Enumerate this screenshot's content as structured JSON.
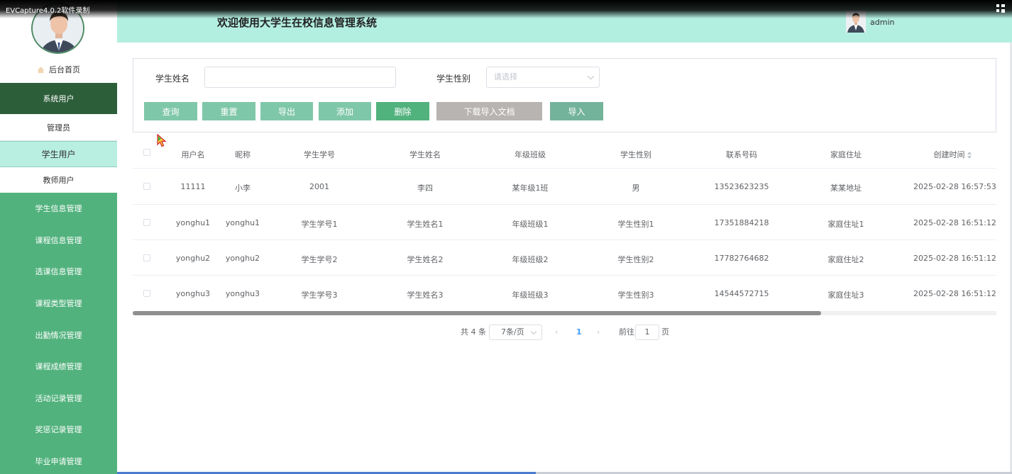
{
  "recorder": {
    "title": "EVCapture4.0.2软件录制"
  },
  "sidebar": {
    "home_label": "后台首页",
    "categories": [
      {
        "label": "系统用户",
        "items": [
          "管理员",
          "学生用户",
          "教师用户"
        ]
      }
    ],
    "menu": [
      "学生信息管理",
      "课程信息管理",
      "选课信息管理",
      "课程类型管理",
      "出勤情况管理",
      "课程成绩管理",
      "活动记录管理",
      "奖惩记录管理",
      "毕业申请管理"
    ]
  },
  "header": {
    "title": "欢迎使用大学生在校信息管理系统",
    "username": "admin"
  },
  "search": {
    "name_label": "学生姓名",
    "name_value": "",
    "gender_label": "学生性别",
    "gender_placeholder": "请选择"
  },
  "buttons": {
    "query": "查询",
    "reset": "重置",
    "export": "导出",
    "add": "添加",
    "delete": "删除",
    "download_template": "下载导入文档",
    "import": "导入"
  },
  "colors": {
    "sidebar_dark": "#2d5e3a",
    "sidebar_green": "#52b27d",
    "header_bg": "#b3efe1",
    "active_item": "#b8efe0",
    "btn_light": "#7fc7a9",
    "btn_delete": "#52b27d",
    "btn_gray": "#b7b4b1",
    "btn_import": "#74b39b"
  },
  "table": {
    "columns": [
      "用户名",
      "昵称",
      "学生学号",
      "学生姓名",
      "年级班级",
      "学生性别",
      "联系号码",
      "家庭住址",
      "创建时间"
    ],
    "rows": [
      [
        "11111",
        "小李",
        "2001",
        "李四",
        "某年级1班",
        "男",
        "13523623235",
        "某某地址",
        "2025-02-28 16:57:53"
      ],
      [
        "yonghu1",
        "yonghu1",
        "学生学号1",
        "学生姓名1",
        "年级班级1",
        "学生性别1",
        "17351884218",
        "家庭住址1",
        "2025-02-28 16:51:12"
      ],
      [
        "yonghu2",
        "yonghu2",
        "学生学号2",
        "学生姓名2",
        "年级班级2",
        "学生性别2",
        "17782764682",
        "家庭住址2",
        "2025-02-28 16:51:12"
      ],
      [
        "yonghu3",
        "yonghu3",
        "学生学号3",
        "学生姓名3",
        "年级班级3",
        "学生性别3",
        "14544572715",
        "家庭住址3",
        "2025-02-28 16:51:12"
      ]
    ]
  },
  "pagination": {
    "total": "共 4 条",
    "page_size": "7条/页",
    "current_page": "1",
    "goto_label": "前往",
    "goto_value": "1",
    "page_unit": "页"
  }
}
